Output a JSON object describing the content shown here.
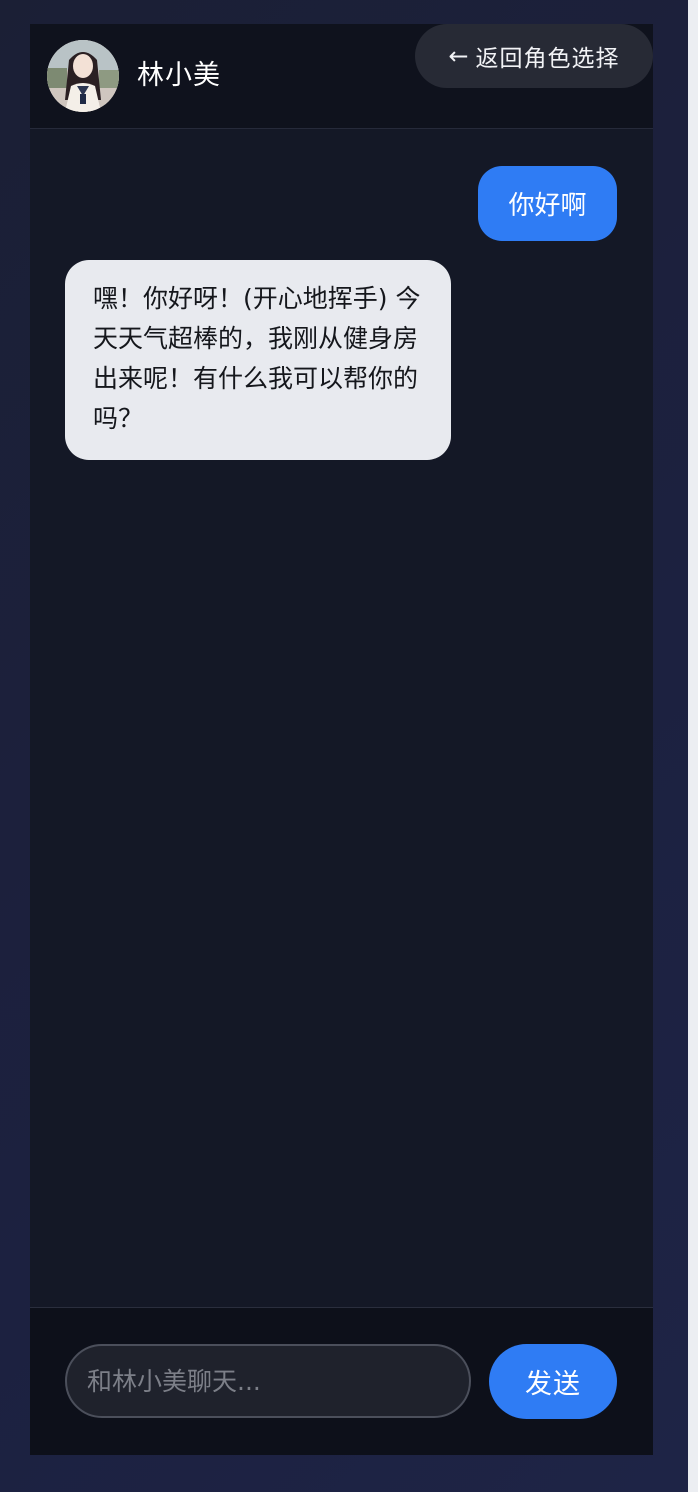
{
  "header": {
    "character_name": "林小美",
    "back_button_label": "返回角色选择",
    "back_arrow": "←",
    "avatar_icon": "character-avatar"
  },
  "messages": [
    {
      "role": "user",
      "text": "你好啊"
    },
    {
      "role": "assistant",
      "text": "嘿！你好呀！(开心地挥手) 今天天气超棒的，我刚从健身房出来呢！有什么我可以帮你的吗？"
    }
  ],
  "composer": {
    "placeholder": "和林小美聊天...",
    "value": "",
    "send_label": "发送"
  },
  "colors": {
    "accent": "#2f7cf4",
    "app_background": "#141826",
    "assistant_bubble": "#e8eaef"
  }
}
